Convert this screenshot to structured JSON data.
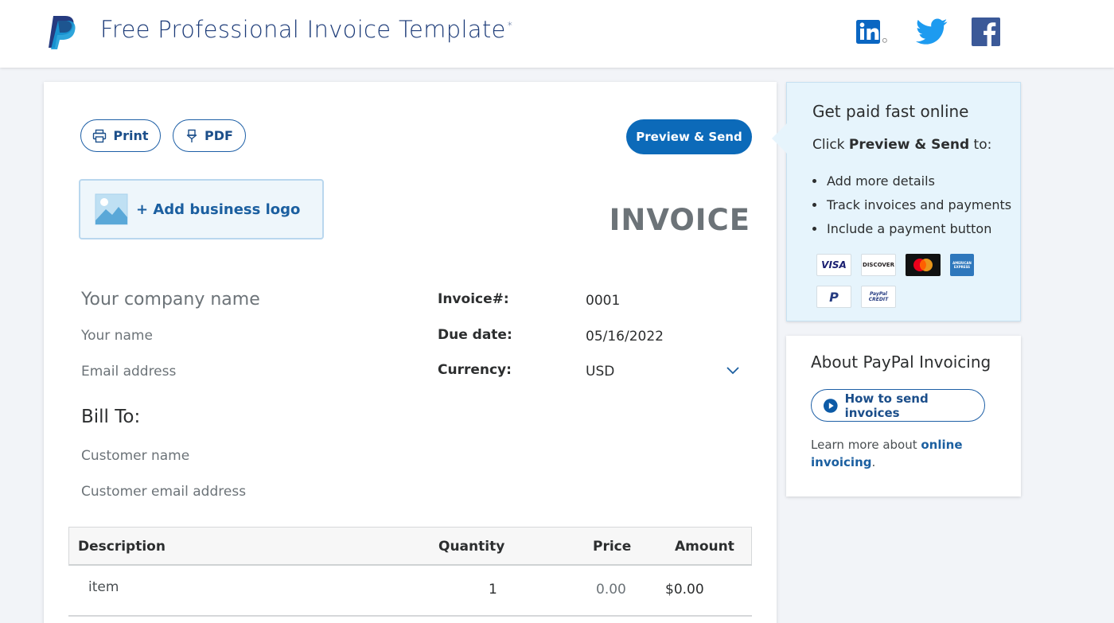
{
  "header": {
    "title": "Free Professional Invoice Template",
    "title_mark": "*",
    "social": [
      "linkedin-icon",
      "twitter-icon",
      "facebook-icon"
    ]
  },
  "toolbar": {
    "print_label": "Print",
    "pdf_label": "PDF",
    "send_label": "Preview & Send"
  },
  "logo": {
    "add_label": "Add business logo"
  },
  "invoice": {
    "title": "INVOICE",
    "from": {
      "company_placeholder": "Your company name",
      "name_placeholder": "Your name",
      "email_placeholder": "Email address"
    },
    "meta": {
      "number_label": "Invoice#:",
      "number_value": "0001",
      "due_label": "Due date:",
      "due_value": "05/16/2022",
      "currency_label": "Currency:",
      "currency_value": "USD"
    },
    "bill_to": {
      "heading": "Bill To:",
      "customer_name_placeholder": "Customer name",
      "customer_email_placeholder": "Customer email address"
    },
    "table": {
      "headers": [
        "Description",
        "Quantity",
        "Price",
        "Amount"
      ],
      "rows": [
        {
          "description": "item",
          "quantity": "1",
          "price": "0.00",
          "amount": "$0.00"
        }
      ]
    }
  },
  "promo": {
    "title": "Get paid fast online",
    "sub_prefix": "Click ",
    "sub_bold": "Preview & Send",
    "sub_suffix": " to:",
    "bullets": [
      "Add more details",
      "Track invoices and payments",
      "Include a payment button"
    ],
    "payment_logos": {
      "visa": "VISA",
      "discover": "DISCOVER",
      "mastercard": "mastercard",
      "amex": "AMERICAN EXPRESS",
      "paypal": "P",
      "paypal_credit": "PayPal CREDIT"
    }
  },
  "about": {
    "title": "About PayPal Invoicing",
    "button_label": "How to send invoices",
    "learn_prefix": "Learn more about ",
    "learn_link": "online invoicing",
    "learn_suffix": "."
  },
  "colors": {
    "brand_blue": "#0c6ab9",
    "navy": "#1c3b78",
    "link_blue": "#1b5fa0",
    "panel_blue": "#e6f4fc"
  }
}
